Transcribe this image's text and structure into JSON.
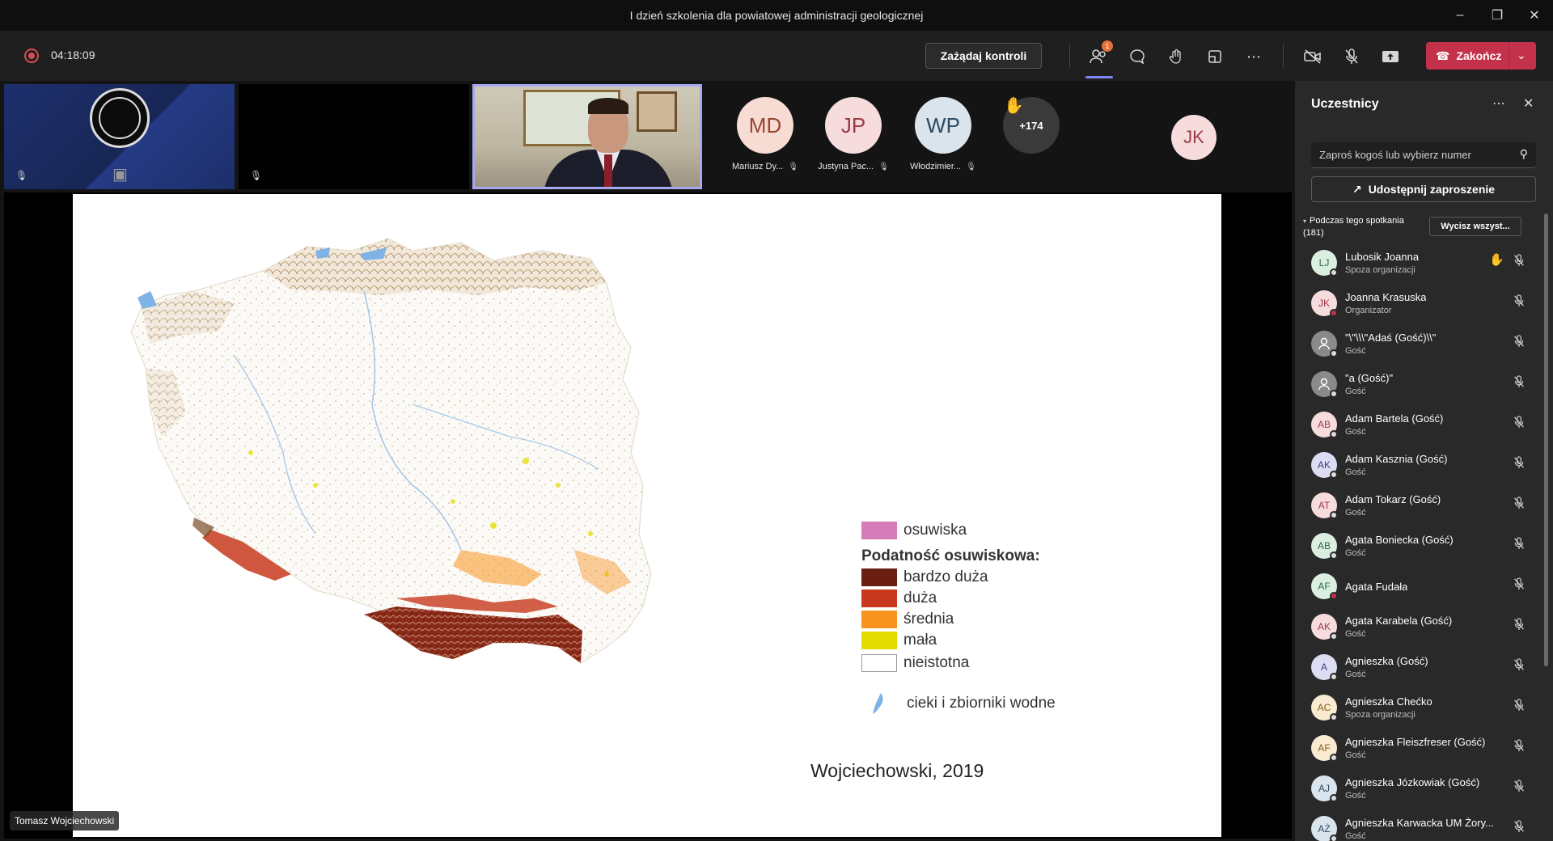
{
  "window": {
    "title": "I dzień szkolenia dla powiatowej administracji geologicznej"
  },
  "toolbar": {
    "timer": "04:18:09",
    "request_control_label": "Zażądaj kontroli",
    "participants_badge": "1",
    "leave_label": "Zakończ"
  },
  "video_strip": {
    "avatars": [
      {
        "initials": "MD",
        "name": "Mariusz Dy...",
        "bg": "#f6dcd2",
        "fg": "#9b4330"
      },
      {
        "initials": "JP",
        "name": "Justyna Pac...",
        "bg": "#f6dcdc",
        "fg": "#9b3b45"
      },
      {
        "initials": "WP",
        "name": "Włodzimier...",
        "bg": "#d9e4ec",
        "fg": "#2e4a60"
      }
    ],
    "overflow_count": "+174",
    "right_avatar_initials": "JK"
  },
  "slide": {
    "legend": {
      "landslides_label": "osuwiska",
      "title": "Podatność osuwiskowa:",
      "classes": [
        {
          "label": "bardzo duża",
          "color": "#6b1f12"
        },
        {
          "label": "duża",
          "color": "#c8391d"
        },
        {
          "label": "średnia",
          "color": "#f7931e"
        },
        {
          "label": "mała",
          "color": "#e4dc00"
        },
        {
          "label": "nieistotna",
          "color": "#ffffff"
        }
      ],
      "landslides_color": "#d77cba",
      "water_label": "cieki i zbiorniki wodne",
      "water_color": "#7fb3e6"
    },
    "credit": "Wojciechowski, 2019"
  },
  "presenter_name": "Tomasz Wojciechowski",
  "panel": {
    "title": "Uczestnicy",
    "invite_placeholder": "Zaproś kogoś lub wybierz numer",
    "share_label": "Udostępnij zaproszenie",
    "section_label_line1": "Podczas tego spotkania",
    "section_label_line2": "(181)",
    "lower_hands_label": "Wycisz wszyst...",
    "participants": [
      {
        "initials": "LJ",
        "name": "Lubosik Joanna",
        "role": "Spoza organizacji",
        "bg": "#dbefe1",
        "fg": "#2f6b3e",
        "hand": true
      },
      {
        "initials": "JK",
        "name": "Joanna Krasuska",
        "role": "Organizator",
        "bg": "#f6dcdc",
        "fg": "#9b3b45",
        "hand": false
      },
      {
        "initials": "",
        "name": "\"\\\"\\\\\\\"Adaś (Gość)\\\\\"",
        "role": "Gość",
        "bg": "#8a8a8a",
        "fg": "#ffffff",
        "hand": false
      },
      {
        "initials": "",
        "name": "\"a (Gość)\"",
        "role": "Gość",
        "bg": "#8a8a8a",
        "fg": "#ffffff",
        "hand": false
      },
      {
        "initials": "AB",
        "name": "Adam Bartela (Gość)",
        "role": "Gość",
        "bg": "#f6dcdc",
        "fg": "#9b3b45",
        "hand": false
      },
      {
        "initials": "AK",
        "name": "Adam Kasznia (Gość)",
        "role": "Gość",
        "bg": "#dcdcf2",
        "fg": "#3d3d85",
        "hand": false
      },
      {
        "initials": "AT",
        "name": "Adam Tokarz (Gość)",
        "role": "Gość",
        "bg": "#f6dcdc",
        "fg": "#9b3b45",
        "hand": false
      },
      {
        "initials": "AB",
        "name": "Agata Boniecka (Gość)",
        "role": "Gość",
        "bg": "#dbefe1",
        "fg": "#2f6b3e",
        "hand": false
      },
      {
        "initials": "AF",
        "name": "Agata Fudała",
        "role": "",
        "bg": "#dbefe1",
        "fg": "#2f6b3e",
        "hand": false
      },
      {
        "initials": "AK",
        "name": "Agata Karabela (Gość)",
        "role": "Gość",
        "bg": "#f6dcdc",
        "fg": "#9b3b45",
        "hand": false
      },
      {
        "initials": "A",
        "name": "Agnieszka (Gość)",
        "role": "Gość",
        "bg": "#dcdcf2",
        "fg": "#3d3d85",
        "hand": false
      },
      {
        "initials": "AC",
        "name": "Agnieszka Chećko",
        "role": "Spoza organizacji",
        "bg": "#f9ead2",
        "fg": "#8a5a14",
        "hand": false
      },
      {
        "initials": "AF",
        "name": "Agnieszka Fleiszfreser (Gość)",
        "role": "Gość",
        "bg": "#f9ead2",
        "fg": "#8a5a14",
        "hand": false
      },
      {
        "initials": "AJ",
        "name": "Agnieszka Józkowiak (Gość)",
        "role": "Gość",
        "bg": "#d9e4ec",
        "fg": "#2e4a60",
        "hand": false
      },
      {
        "initials": "AŻ",
        "name": "Agnieszka Karwacka UM Żory...",
        "role": "Gość",
        "bg": "#d9e4ec",
        "fg": "#2e4a60",
        "hand": false
      }
    ]
  }
}
